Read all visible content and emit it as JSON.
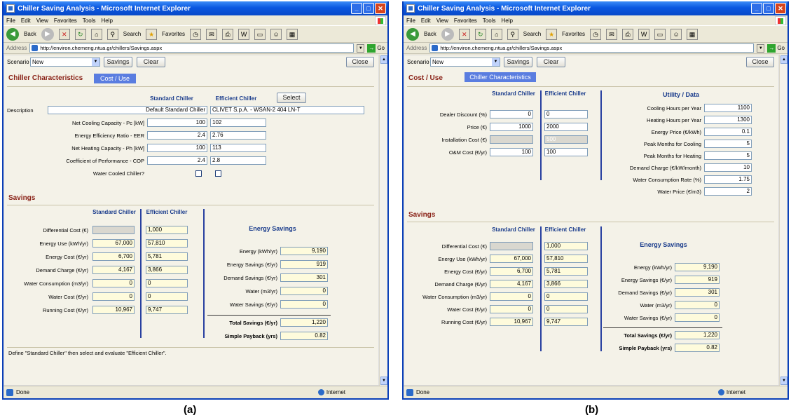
{
  "browser": {
    "title": "Chiller Saving Analysis - Microsoft Internet Explorer",
    "menu": [
      "File",
      "Edit",
      "View",
      "Favorites",
      "Tools",
      "Help"
    ],
    "toolbar": {
      "back": "Back",
      "search": "Search",
      "favorites": "Favorites"
    },
    "address_label": "Address",
    "url": "http://environ.chemeng.ntua.gr/chillers/Savings.aspx",
    "go": "Go",
    "status_done": "Done",
    "status_zone": "Internet"
  },
  "controls": {
    "scenario_label": "Scenario",
    "scenario_value": "New",
    "savings_button": "Savings",
    "clear_button": "Clear",
    "close_button": "Close"
  },
  "panel_a": {
    "section_title": "Chiller Characteristics",
    "tab_label": "Cost / Use",
    "col_standard": "Standard Chiller",
    "col_efficient": "Efficient Chiller",
    "select_button": "Select",
    "description_label": "Description",
    "description_standard": "Default Standard Chiller",
    "description_efficient": "CLIVET S.p.A. - WSAN-2 404 LN-T",
    "rows": [
      {
        "label": "Net Cooling Capacity - Pc [kW]",
        "standard": "100",
        "efficient": "102"
      },
      {
        "label": "Energy Efficiency Ratio - EER",
        "standard": "2.4",
        "efficient": "2.76"
      },
      {
        "label": "Net Heating Capacity - Ph [kW]",
        "standard": "100",
        "efficient": "113"
      },
      {
        "label": "Coefficient of Performance - COP",
        "standard": "2.4",
        "efficient": "2.8"
      }
    ],
    "water_cooled_label": "Water Cooled Chiller?",
    "footnote": "Define \"Standard Chiller\" then select and evaluate \"Efficient Chiller\".",
    "caption": "(a)"
  },
  "panel_b": {
    "section_title": "Cost / Use",
    "tab_label": "Chiller Characteristics",
    "col_standard": "Standard Chiller",
    "col_efficient": "Efficient Chiller",
    "rows": [
      {
        "label": "Dealer Discount (%)",
        "standard": "0",
        "efficient": "0"
      },
      {
        "label": "Price (€)",
        "standard": "1000",
        "efficient": "2000"
      },
      {
        "label": "Installation Cost (€)",
        "standard": "",
        "efficient": "500"
      },
      {
        "label": "O&M Cost (€/yr)",
        "standard": "100",
        "efficient": "100"
      }
    ],
    "utility_title": "Utility / Data",
    "utility": [
      {
        "label": "Cooling Hours per Year",
        "value": "1100"
      },
      {
        "label": "Heating Hours per Year",
        "value": "1300"
      },
      {
        "label": "Energy Price (€/kWh)",
        "value": "0.1"
      },
      {
        "label": "Peak Months for Cooling",
        "value": "5"
      },
      {
        "label": "Peak Months for Heating",
        "value": "5"
      },
      {
        "label": "Demand Charge (€/kW/month)",
        "value": "10"
      },
      {
        "label": "Water Consumption Rate (%)",
        "value": "1.75"
      },
      {
        "label": "Water Price (€/m3)",
        "value": "2"
      }
    ],
    "caption": "(b)"
  },
  "savings": {
    "title": "Savings",
    "col_standard": "Standard Chiller",
    "col_efficient": "Efficient Chiller",
    "rows": [
      {
        "label": "Differential Cost (€)",
        "standard": "",
        "efficient": "1,000"
      },
      {
        "label": "Energy Use (kWh/yr)",
        "standard": "67,000",
        "efficient": "57,810"
      },
      {
        "label": "Energy Cost (€/yr)",
        "standard": "6,700",
        "efficient": "5,781"
      },
      {
        "label": "Demand Charge (€/yr)",
        "standard": "4,167",
        "efficient": "3,866"
      },
      {
        "label": "Water Consumption (m3/yr)",
        "standard": "0",
        "efficient": "0"
      },
      {
        "label": "Water Cost (€/yr)",
        "standard": "0",
        "efficient": "0"
      },
      {
        "label": "Running Cost (€/yr)",
        "standard": "10,967",
        "efficient": "9,747"
      }
    ],
    "energy_title": "Energy Savings",
    "energy": [
      {
        "label": "Energy (kWh/yr)",
        "value": "9,190"
      },
      {
        "label": "Energy Savings (€/yr)",
        "value": "919"
      },
      {
        "label": "Demand Savings (€/yr)",
        "value": "301"
      },
      {
        "label": "Water (m3/yr)",
        "value": "0"
      },
      {
        "label": "Water Savings (€/yr)",
        "value": "0"
      }
    ],
    "total_label": "Total Savings (€/yr)",
    "total_value": "1,220",
    "payback_label": "Simple Payback (yrs)",
    "payback_value": "0.82"
  }
}
